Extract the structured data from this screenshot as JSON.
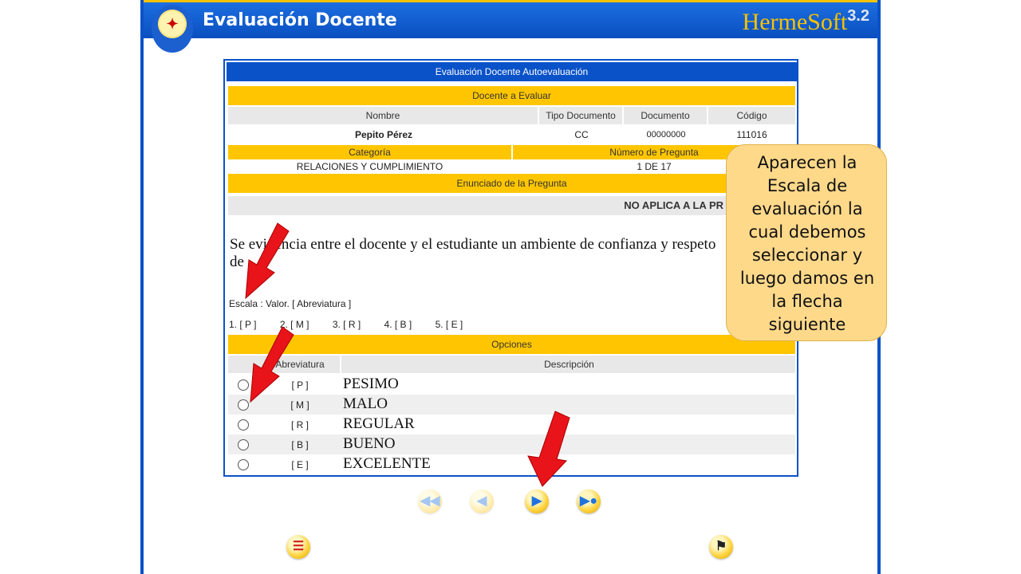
{
  "header": {
    "app_title": "Evaluación Docente",
    "brand": "HermeSoft",
    "version": "3.2"
  },
  "panel": {
    "title": "Evaluación Docente Autoevaluación",
    "docente_section": "Docente a Evaluar",
    "columns": {
      "nombre": "Nombre",
      "tipo_documento": "Tipo Documento",
      "documento": "Documento",
      "codigo": "Código"
    },
    "teacher": {
      "nombre": "Pepito Pérez",
      "tipo_documento": "CC",
      "documento": "00000000",
      "codigo": "111016"
    },
    "categoria_label": "Categoría",
    "numero_label": "Número de Pregunta",
    "categoria_value": "RELACIONES Y CUMPLIMIENTO",
    "numero_value": "1 DE 17",
    "enunciado_label": "Enunciado de la Pregunta",
    "no_aplica": "NO APLICA A LA PR",
    "question_line1": "Se evidencia entre el docente y el estudiante un ambiente de confianza y respeto",
    "question_line2": "de",
    "scale_label": "Escala : Valor. [ Abreviatura ]",
    "scale_items": [
      "1. [ P ]",
      "2. [ M ]",
      "3. [ R ]",
      "4. [ B ]",
      "5. [ E ]"
    ],
    "opciones_label": "Opciones",
    "abreviatura_header": "Abreviatura",
    "descripcion_header": "Descripción",
    "options": [
      {
        "abbr": "[ P ]",
        "desc": "PESIMO"
      },
      {
        "abbr": "[ M ]",
        "desc": "MALO"
      },
      {
        "abbr": "[ R ]",
        "desc": "REGULAR"
      },
      {
        "abbr": "[ B ]",
        "desc": "BUENO"
      },
      {
        "abbr": "[ E ]",
        "desc": "EXCELENTE"
      }
    ]
  },
  "callout": [
    "Aparecen la",
    "Escala de",
    "evaluación la",
    "cual debemos",
    "seleccionar y",
    "luego damos en",
    "la flecha",
    "siguiente"
  ],
  "colors": {
    "blue": "#0a52c8",
    "yellow": "#ffc600",
    "arrow": "#e8141a"
  }
}
